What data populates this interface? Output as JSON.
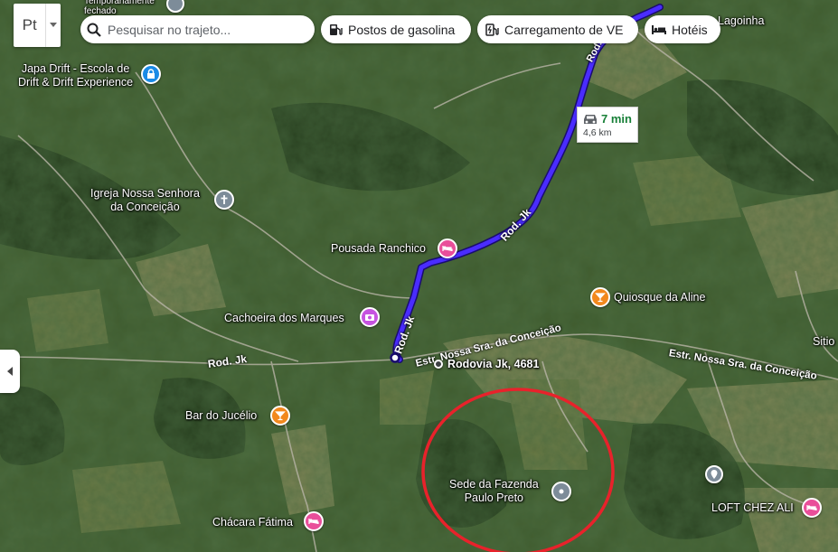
{
  "search": {
    "placeholder": "Pesquisar no trajeto..."
  },
  "layers_button": {
    "label": "Pt"
  },
  "chips": [
    {
      "label": "Postos de gasolina",
      "icon": "gas-station-icon"
    },
    {
      "label": "Carregamento de VE",
      "icon": "ev-charger-icon"
    },
    {
      "label": "Hotéis",
      "icon": "bed-icon"
    }
  ],
  "route": {
    "time": "7 min",
    "distance": "4,6 km",
    "color": "#4a2cff"
  },
  "places": {
    "japa": "Japa Drift - Escola de\nDrift & Drift Experience",
    "temp_closed": "Temporariamente\nfechado",
    "igreja": "Igreja Nossa Senhora\nda Conceição",
    "pousada": "Pousada Ranchico",
    "cachoeira": "Cachoeira dos Marques",
    "quiosque": "Quiosque da Aline",
    "rodovia": "Rodovia Jk, 4681",
    "bar": "Bar do Jucélio",
    "sede": "Sede da Fazenda\nPaulo Preto",
    "loft": "LOFT CHEZ ALI",
    "chacara": "Chácara Fátima",
    "lagoinha": "Lagoinha",
    "sitio": "Sitio"
  },
  "roads": {
    "rod_jk_1": "Rod. Jk",
    "rod_jk_2": "Rod. Jk",
    "rod_jk_3": "Rod. Jk",
    "rod_jk_4": "Rod. Jk",
    "estr_1": "Estr. Nossa Sra. da Conceição",
    "estr_2": "Estr. Nossa Sra. da Conceição"
  },
  "colors": {
    "hotel_pink": "#e94e9a",
    "food_orange": "#f2881d",
    "activity_blue": "#1a8ae6",
    "attraction_purple": "#c653e0",
    "church_gray": "#7d8c99",
    "highlight_circle": "#e8222b"
  }
}
